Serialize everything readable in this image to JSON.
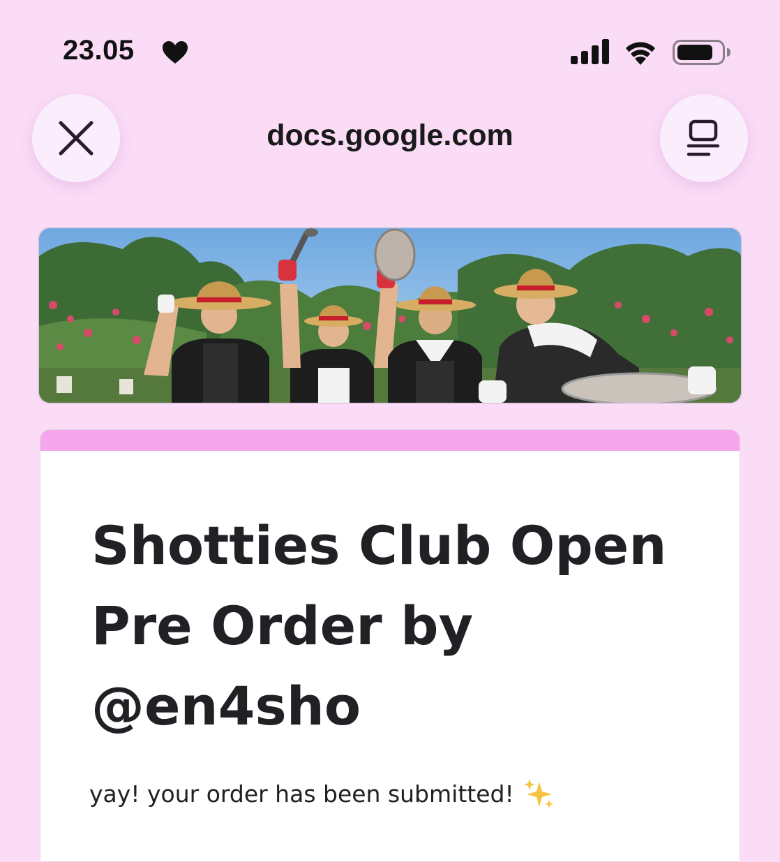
{
  "status_bar": {
    "time": "23.05",
    "icons": [
      "heart-icon",
      "cellular-signal-icon",
      "wifi-icon",
      "battery-icon"
    ]
  },
  "browser": {
    "url": "docs.google.com",
    "close_icon": "close-icon",
    "menu_icon": "reader-menu-icon"
  },
  "form": {
    "accent_color": "#f6a7ec",
    "background_color": "#fadcf7",
    "title": "Shotties Club Open Pre Order by @en4sho",
    "confirmation": "yay! your order has been submitted!",
    "confirmation_icon": "sparkles-icon"
  }
}
